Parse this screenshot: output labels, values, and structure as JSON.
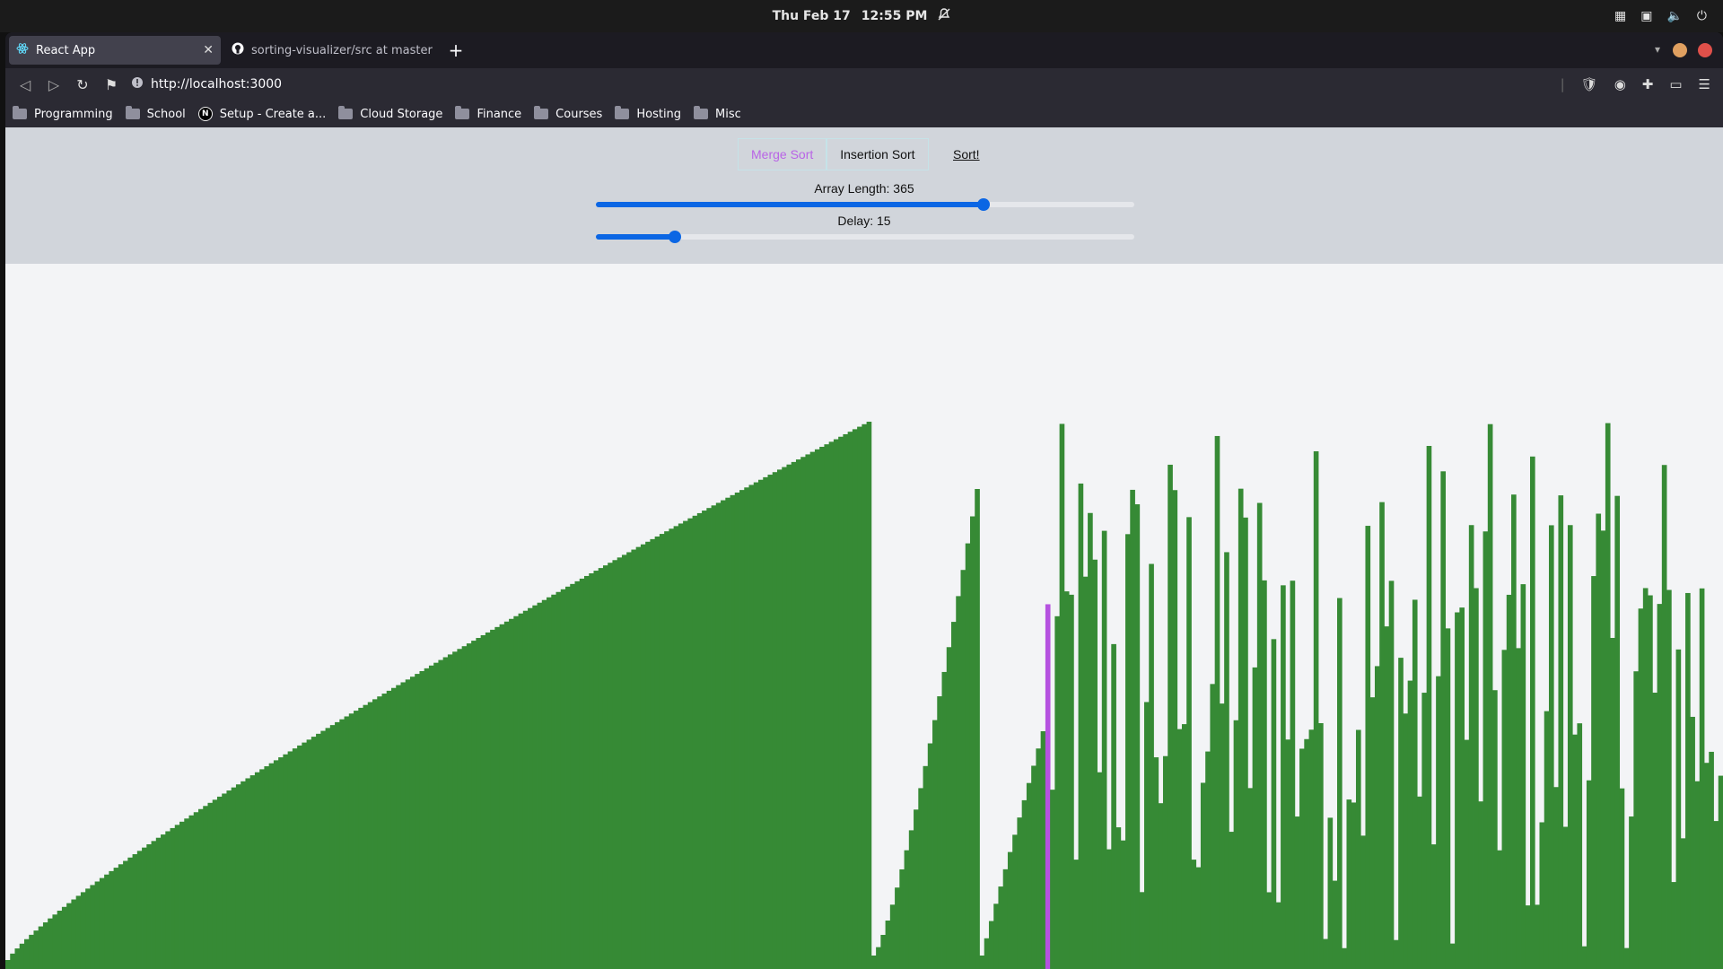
{
  "topbar": {
    "date": "Thu Feb 17",
    "time": "12:55 PM",
    "notification_icon": "bell-muted-icon"
  },
  "browser": {
    "tabs": [
      {
        "title": "React App",
        "icon": "react-icon",
        "active": true
      },
      {
        "title": "sorting-visualizer/src at master · ",
        "icon": "github-icon",
        "active": false
      }
    ],
    "url": "http://localhost:3000",
    "bookmarks": [
      {
        "label": "Programming",
        "icon": "folder-icon"
      },
      {
        "label": "School",
        "icon": "folder-icon"
      },
      {
        "label": "Setup - Create a...",
        "icon": "notion-icon"
      },
      {
        "label": "Cloud Storage",
        "icon": "folder-icon"
      },
      {
        "label": "Finance",
        "icon": "folder-icon"
      },
      {
        "label": "Courses",
        "icon": "folder-icon"
      },
      {
        "label": "Hosting",
        "icon": "folder-icon"
      },
      {
        "label": "Misc",
        "icon": "folder-icon"
      }
    ]
  },
  "app": {
    "algorithms": [
      "Merge Sort",
      "Insertion Sort"
    ],
    "selected_algorithm": "Merge Sort",
    "sort_label": "Sort!",
    "array_length_label": "Array Length: 365",
    "array_length": 365,
    "array_length_fraction": 0.72,
    "delay_label": "Delay: 15",
    "delay": 15,
    "delay_fraction": 0.147,
    "colors": {
      "bar": "#368a35",
      "active_bar": "#b552e0",
      "selected_text": "#b964e6",
      "slider": "#0b66e4"
    }
  }
}
